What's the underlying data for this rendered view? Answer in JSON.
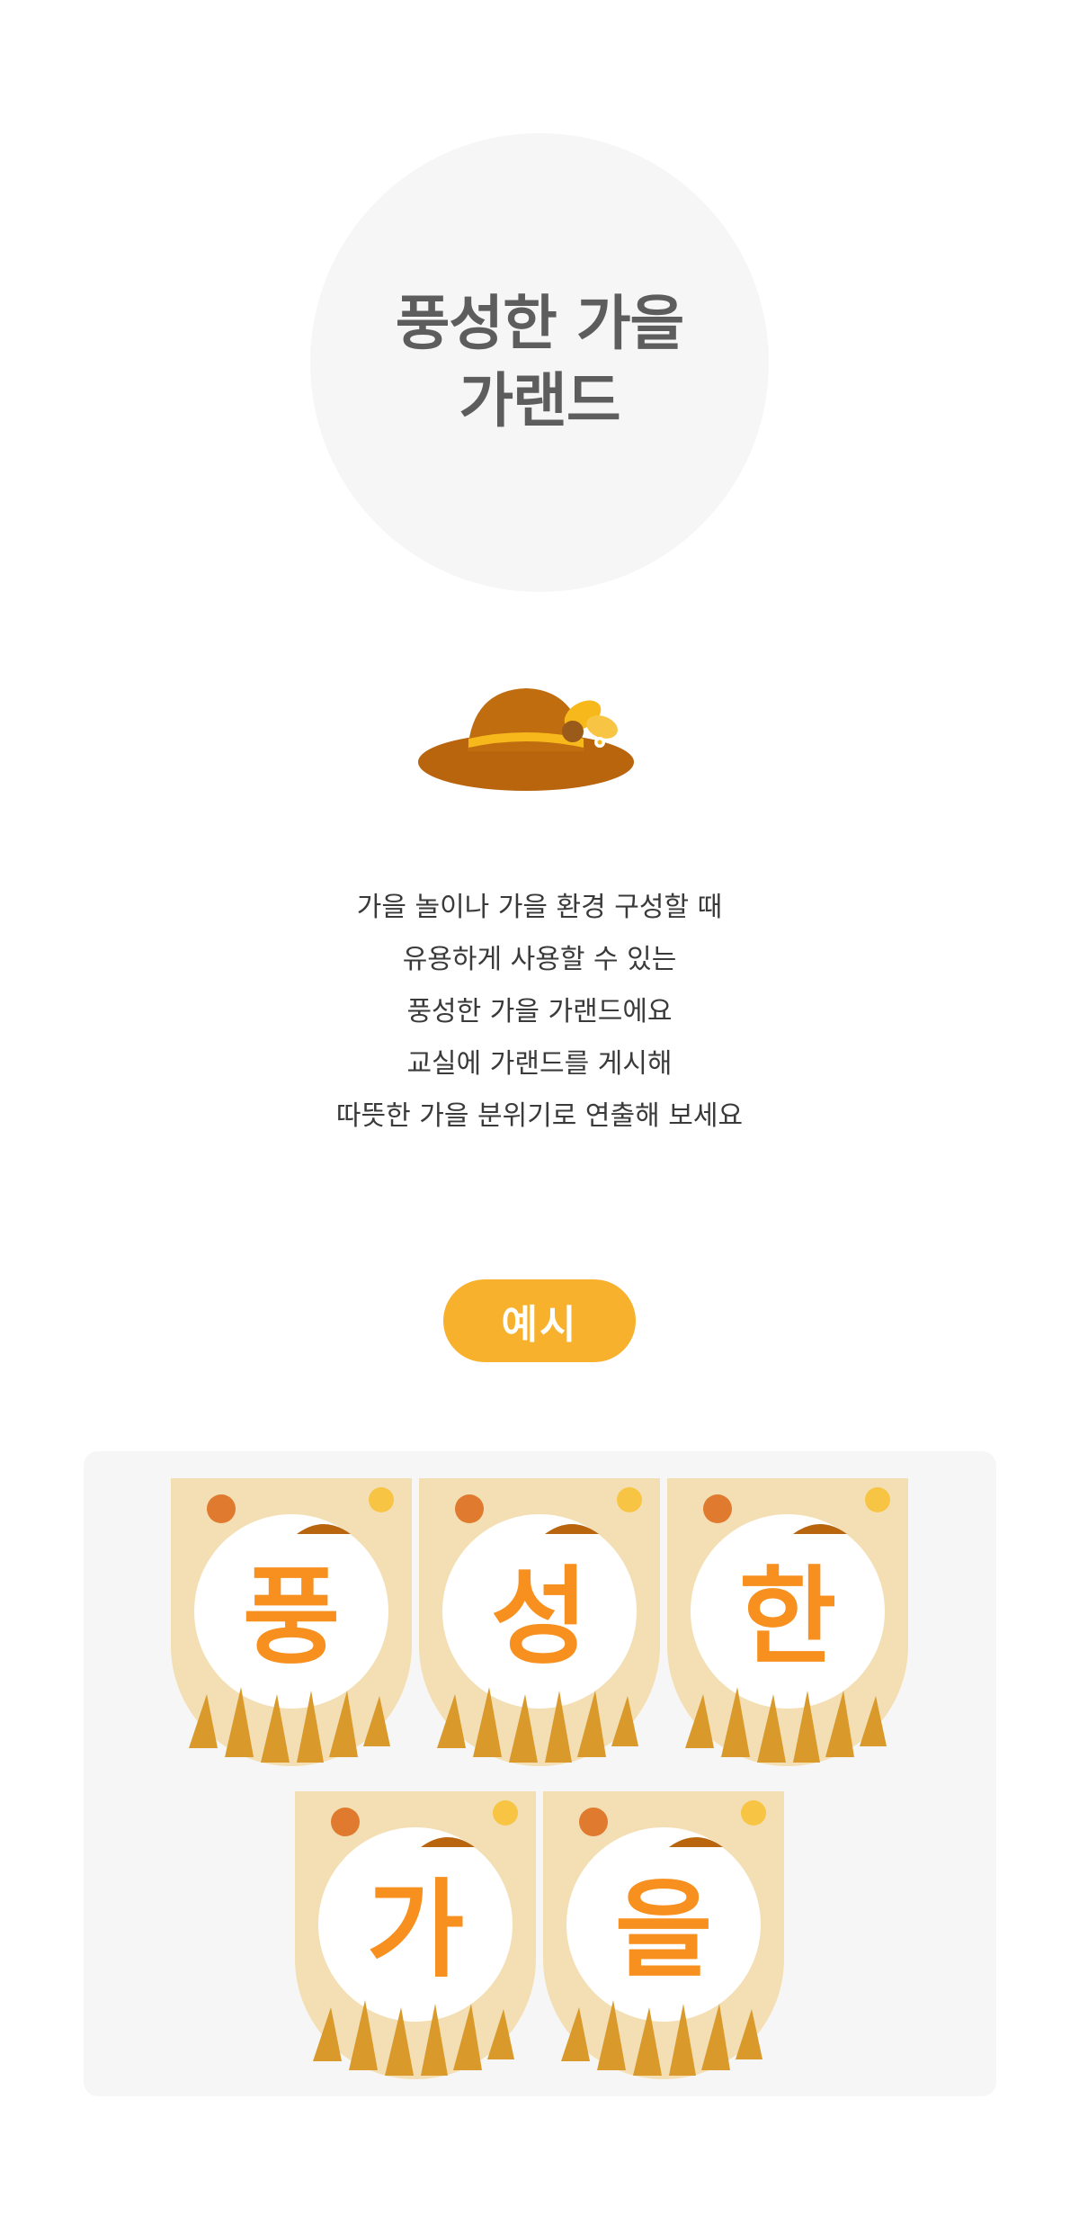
{
  "hero": {
    "title_line1": "풍성한 가을",
    "title_line2": "가랜드"
  },
  "description": [
    "가을 놀이나 가을 환경 구성할 때",
    "유용하게 사용할 수 있는",
    "풍성한 가을 가랜드에요",
    "교실에 가랜드를 게시해",
    "따뜻한 가을 분위기로 연출해 보세요"
  ],
  "badge": {
    "label": "예시"
  },
  "garland": {
    "letters": [
      "풍",
      "성",
      "한",
      "가",
      "을"
    ],
    "letter_color": "#f7901e",
    "flag_bg": "#f3dfb3"
  },
  "colors": {
    "accent": "#f8b12c",
    "hat": "#b9650e",
    "panel_bg": "#f6f6f6"
  }
}
